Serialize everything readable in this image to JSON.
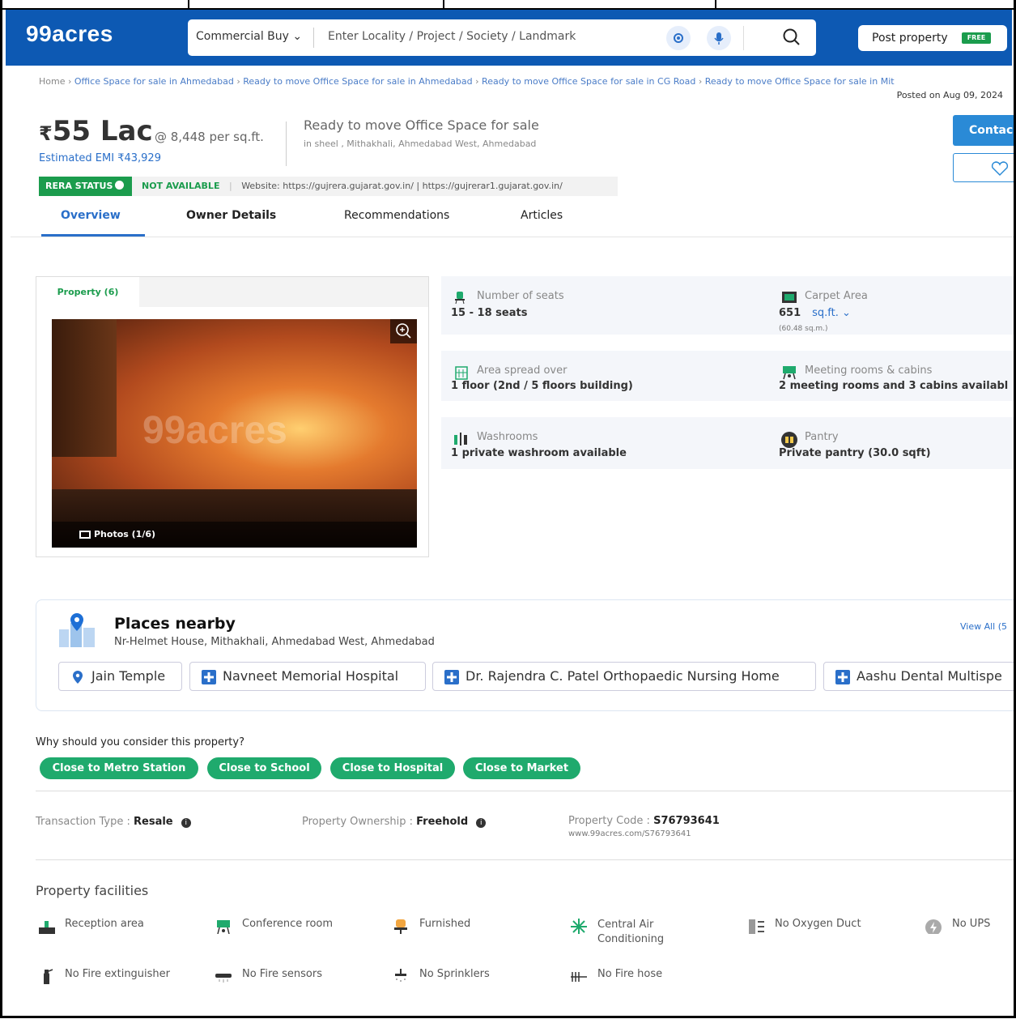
{
  "header": {
    "logo": "99acres",
    "search_type": "Commercial Buy",
    "search_placeholder": "Enter Locality / Project / Society / Landmark",
    "post_label": "Post property",
    "post_badge": "FREE",
    "brand_color": "#0d59b3"
  },
  "breadcrumb": {
    "items": [
      "Home",
      "Office Space for sale in Ahmedabad",
      "Ready to move Office Space for sale in Ahmedabad",
      "Ready to move Office Space for sale in CG Road",
      "Ready to move Office Space for sale in Mit"
    ],
    "posted": "Posted on Aug 09, 2024"
  },
  "summary": {
    "currency": "₹",
    "price": "55 Lac",
    "per_sqft": "@ 8,448 per sq.ft.",
    "emi": "Estimated EMI ₹43,929",
    "title": "Ready to move Office Space for sale",
    "location": "in sheel , Mithakhali, Ahmedabad West, Ahmedabad",
    "contact_label": "Contac"
  },
  "rera": {
    "label": "RERA STATUS",
    "status": "NOT AVAILABLE",
    "website": "Website: https://gujrera.gujarat.gov.in/ | https://gujrerar1.gujarat.gov.in/"
  },
  "tabs": [
    "Overview",
    "Owner Details",
    "Recommendations",
    "Articles"
  ],
  "gallery": {
    "tab_label": "Property (6)",
    "watermark": "99acres",
    "caption": "Photos (1/6)"
  },
  "details": [
    {
      "label": "Number of seats",
      "value": "15 - 18 seats"
    },
    {
      "label": "Carpet Area",
      "value": "651",
      "unit": "sq.ft.",
      "sub": "(60.48 sq.m.)"
    },
    {
      "label": "Area spread over",
      "value": "1 floor (2nd / 5 floors building)"
    },
    {
      "label": "Meeting rooms & cabins",
      "value": "2 meeting rooms and 3 cabins availabl"
    },
    {
      "label": "Washrooms",
      "value": "1 private washroom available"
    },
    {
      "label": "Pantry",
      "value": "Private pantry (30.0 sqft)"
    }
  ],
  "nearby": {
    "title": "Places nearby",
    "subtitle": "Nr-Helmet House, Mithakhali, Ahmedabad West, Ahmedabad",
    "view_all": "View All (5",
    "places": [
      "Jain Temple",
      "Navneet Memorial Hospital",
      "Dr. Rajendra C. Patel Orthopaedic Nursing Home",
      "Aashu Dental Multispe"
    ]
  },
  "why": {
    "title": "Why should you consider this property?",
    "tags": [
      "Close to Metro Station",
      "Close to School",
      "Close to Hospital",
      "Close to Market"
    ]
  },
  "meta": {
    "transaction_label": "Transaction Type : ",
    "transaction_value": "Resale",
    "ownership_label": "Property Ownership : ",
    "ownership_value": "Freehold",
    "code_label": "Property Code : ",
    "code_value": "S76793641",
    "code_url": "www.99acres.com/S76793641"
  },
  "facilities": {
    "title": "Property facilities",
    "items": [
      "Reception area",
      "Conference room",
      "Furnished",
      "Central Air Conditioning",
      "No Oxygen Duct",
      "No UPS",
      "No Fire extinguisher",
      "No Fire sensors",
      "No Sprinklers",
      "No Fire hose"
    ]
  }
}
